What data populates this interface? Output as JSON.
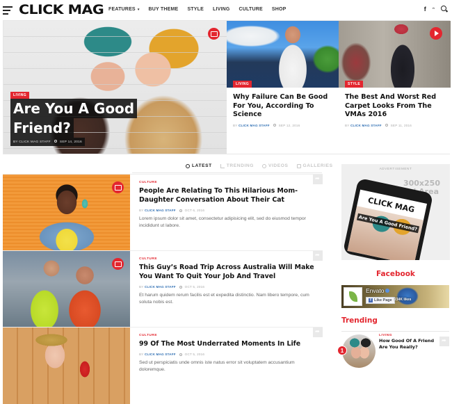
{
  "header": {
    "logo": "CLICK MAG",
    "nav": [
      {
        "label": "FEATURES",
        "has_dropdown": true
      },
      {
        "label": "BUY THEME"
      },
      {
        "label": "STYLE"
      },
      {
        "label": "LIVING"
      },
      {
        "label": "CULTURE"
      },
      {
        "label": "SHOP"
      }
    ],
    "dropdown_caret": "▾",
    "social": {
      "facebook": "f",
      "twitter": "🐦"
    },
    "icons": [
      "hamburger-menu-icon",
      "facebook-icon",
      "twitter-icon",
      "search-icon"
    ]
  },
  "featured": {
    "main": {
      "category": "LIVING",
      "title_lines": [
        "Are You A Good",
        "Friend?"
      ],
      "author_prefix": "BY",
      "author": "CLICK MAG STAFF",
      "date": "SEP 14, 2016",
      "media_icon": "camera-icon"
    },
    "secondary": [
      {
        "category": "LIVING",
        "title": "Why Failure Can Be Good For You, According To Science",
        "author_prefix": "BY",
        "author": "CLICK MAG STAFF",
        "date": "SEP 12, 2016"
      },
      {
        "category": "STYLE",
        "title": "The Best And Worst Red Carpet Looks From The VMAs 2016",
        "author_prefix": "BY",
        "author": "CLICK MAG STAFF",
        "date": "SEP 11, 2016",
        "media_icon": "play-icon"
      }
    ]
  },
  "tabs": [
    {
      "label": "LATEST",
      "icon": "clock-icon",
      "active": true
    },
    {
      "label": "TRENDING",
      "icon": "trending-icon",
      "active": false
    },
    {
      "label": "VIDEOS",
      "icon": "video-icon",
      "active": false
    },
    {
      "label": "GALLERIES",
      "icon": "camera-icon",
      "active": false
    }
  ],
  "articles": [
    {
      "category": "CULTURE",
      "title": "People Are Relating To This Hilarious Mom-Daughter Conversation About Their Cat",
      "author_prefix": "BY",
      "author": "CLICK MAG STAFF",
      "date": "OCT 6, 2016",
      "excerpt": "Lorem ipsum dolor sit amet, consectetur adipisicing elit, sed do eiusmod tempor incididunt ut labore.",
      "media_icon": "camera-icon"
    },
    {
      "category": "CULTURE",
      "title": "This Guy’s Road Trip Across Australia Will Make You Want To Quit Your Job And Travel",
      "author_prefix": "BY",
      "author": "CLICK MAG STAFF",
      "date": "OCT 5, 2016",
      "excerpt": "Et harum quidem rerum facilis est et expedita distinctio. Nam libero tempore, cum soluta nobis est.",
      "media_icon": "camera-icon"
    },
    {
      "category": "CULTURE",
      "title": "99 Of The Most Underrated Moments In Life",
      "author_prefix": "BY",
      "author": "CLICK MAG STAFF",
      "date": "OCT 5, 2016",
      "excerpt": "Sed ut perspiciatis unde omnis iste natus error sit voluptatem accusantium doloremque."
    }
  ],
  "sidebar": {
    "ad": {
      "label": "ADVERTISEMENT",
      "size_line1": "300x250",
      "size_line2": "Ad Area",
      "phone_logo": "CLICK MAG",
      "phone_title": "Are You A Good Friend?"
    },
    "facebook": {
      "heading": "Facebook",
      "page_name": "Envato",
      "like_button": "Like Page",
      "likes": "234K likes"
    },
    "trending": {
      "heading": "Trending",
      "items": [
        {
          "rank": "1",
          "category": "LIVING",
          "title": "How Good Of A Friend Are You Really?"
        }
      ]
    }
  },
  "colors": {
    "accent": "#e3262f",
    "author_link": "#2f6fb3",
    "text": "#111111",
    "muted": "#aaaaaa"
  }
}
